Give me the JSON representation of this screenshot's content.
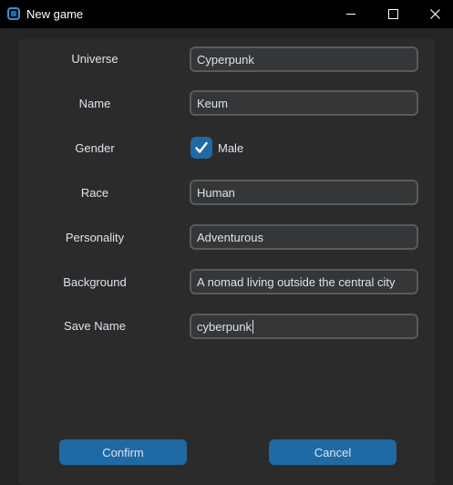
{
  "window": {
    "title": "New game",
    "icon": "app-window-icon"
  },
  "form": {
    "universe": {
      "label": "Universe",
      "value": "Cyperpunk"
    },
    "name": {
      "label": "Name",
      "value": "Keum"
    },
    "gender": {
      "label": "Gender",
      "checkbox_label": "Male",
      "checked": true
    },
    "race": {
      "label": "Race",
      "value": "Human"
    },
    "personality": {
      "label": "Personality",
      "value": "Adventurous"
    },
    "background": {
      "label": "Background",
      "value": "A nomad living outside the central city"
    },
    "save_name": {
      "label": "Save Name",
      "value": "cyberpunk"
    }
  },
  "actions": {
    "confirm_label": "Confirm",
    "cancel_label": "Cancel"
  },
  "colors": {
    "accent": "#1f6aa5",
    "panel": "#2b2b2b",
    "window_bg": "#242424",
    "entry_bg": "#343638",
    "entry_border": "#565b5e"
  }
}
